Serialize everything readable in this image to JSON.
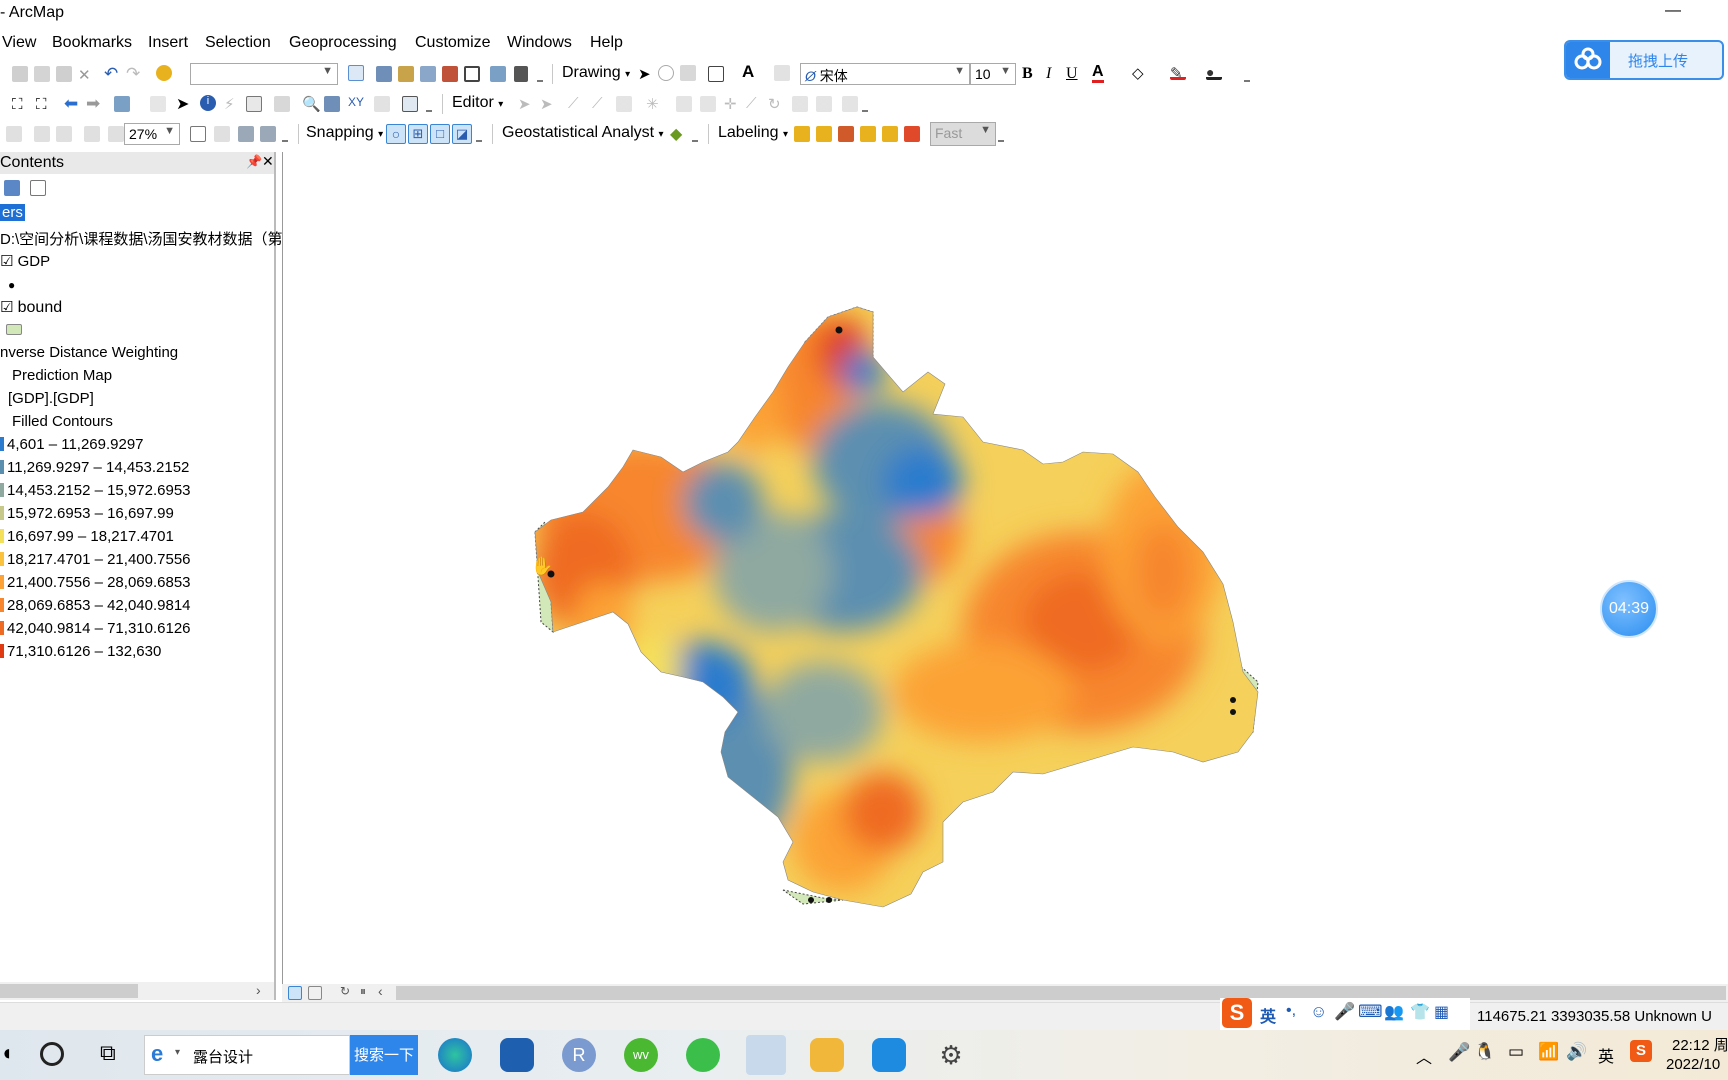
{
  "window": {
    "title": "- ArcMap",
    "minimize_glyph": "—"
  },
  "menu": [
    "View",
    "Bookmarks",
    "Insert",
    "Selection",
    "Geoprocessing",
    "Customize",
    "Windows",
    "Help"
  ],
  "toolbar1": {
    "drawing_label": "Drawing",
    "font_name": "宋体",
    "font_size": "10",
    "bold": "B",
    "italic": "I",
    "underline": "U",
    "text_color_glyph": "A"
  },
  "toolbar2": {
    "editor_label": "Editor"
  },
  "toolbar3": {
    "zoom_level": "27%",
    "snapping_label": "Snapping",
    "geostat_label": "Geostatistical Analyst",
    "labeling_label": "Labeling",
    "fast_label": "Fast"
  },
  "toc": {
    "title": "Contents",
    "layers_label": "ers",
    "data_path": "D:\\空间分析\\课程数据\\汤国安教材数据（第",
    "layer_gdp": "GDP",
    "layer_bound": "bound",
    "idw": "nverse Distance Weighting",
    "prediction_map": "Prediction Map",
    "field": "[GDP].[GDP]",
    "filled_contours": "Filled Contours",
    "classes": [
      {
        "label": "4,601 – 11,269.9297",
        "color": "#2b7bce"
      },
      {
        "label": "11,269.9297 – 14,453.2152",
        "color": "#5b8fb0"
      },
      {
        "label": "14,453.2152 – 15,972.6953",
        "color": "#8fa9a0"
      },
      {
        "label": "15,972.6953 – 16,697.99",
        "color": "#c6c98a"
      },
      {
        "label": "16,697.99 – 18,217.4701",
        "color": "#f5e05a"
      },
      {
        "label": "18,217.4701 – 21,400.7556",
        "color": "#fbc33d"
      },
      {
        "label": "21,400.7556 – 28,069.6853",
        "color": "#fca236"
      },
      {
        "label": "28,069.6853 – 42,040.9814",
        "color": "#f7862e"
      },
      {
        "label": "42,040.9814 – 71,310.6126",
        "color": "#ef6a22"
      },
      {
        "label": "71,310.6126 – 132,630",
        "color": "#e03a12"
      }
    ]
  },
  "status": {
    "coordinates": "114675.21  3393035.58 Unknown U"
  },
  "overlay": {
    "upload_label": "拖拽上传",
    "timer": "04:39"
  },
  "taskbar": {
    "search_text": "露台设计",
    "search_button": "搜索一下",
    "time": "22:12 周",
    "date": "2022/10",
    "ime_label": "英",
    "ime_lang": "英"
  }
}
